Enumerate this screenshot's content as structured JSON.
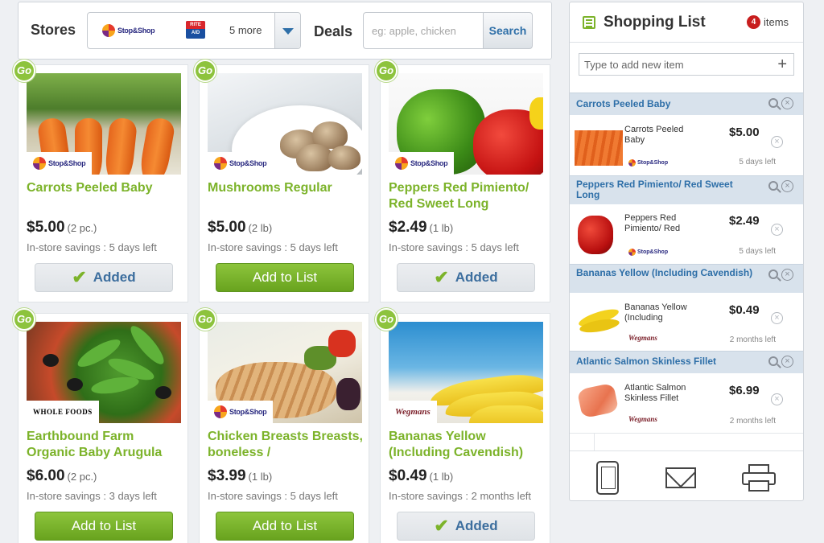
{
  "search": {
    "stores_label": "Stores",
    "store_logos": [
      "Stop&Shop",
      "RITE AID"
    ],
    "more_stores": "5 more",
    "deals_label": "Deals",
    "deals_placeholder": "eg: apple, chicken",
    "search_label": "Search"
  },
  "products": [
    {
      "title": "Carrots Peeled Baby",
      "price": "$5.00",
      "qty": "(2 pc.)",
      "savings": "In-store savings : 5 days left",
      "store": "Stop&Shop",
      "action": "Added",
      "badge": "Go"
    },
    {
      "title": "Mushrooms Regular",
      "price": "$5.00",
      "qty": "(2 lb)",
      "savings": "In-store savings : 5 days left",
      "store": "Stop&Shop",
      "action": "Add to List",
      "badge": "Go"
    },
    {
      "title": "Peppers Red Pimiento/ Red Sweet Long",
      "price": "$2.49",
      "qty": "(1 lb)",
      "savings": "In-store savings : 5 days left",
      "store": "Stop&Shop",
      "action": "Added",
      "badge": "Go"
    },
    {
      "title": "Earthbound Farm Organic Baby Arugula",
      "price": "$6.00",
      "qty": "(2 pc.)",
      "savings": "In-store savings : 3 days left",
      "store": "WHOLE FOODS",
      "action": "Add to List",
      "badge": "Go"
    },
    {
      "title": "Chicken Breasts Breasts, boneless /",
      "price": "$3.99",
      "qty": "(1 lb)",
      "savings": "In-store savings : 5 days left",
      "store": "Stop&Shop",
      "action": "Add to List",
      "badge": "Go"
    },
    {
      "title": "Bananas Yellow (Including Cavendish)",
      "price": "$0.49",
      "qty": "(1 lb)",
      "savings": "In-store savings : 2 months left",
      "store": "Wegmans",
      "action": "Added",
      "badge": "Go"
    }
  ],
  "shopping_list": {
    "title": "Shopping List",
    "count": "4",
    "count_label": "items",
    "add_placeholder": "Type to add new item",
    "add_symbol": "+",
    "items": [
      {
        "section": "Carrots Peeled Baby",
        "name": "Carrots Peeled Baby",
        "price": "$5.00",
        "store": "Stop&Shop",
        "time": "5 days left"
      },
      {
        "section": "Peppers Red Pimiento/ Red Sweet Long",
        "name": "Peppers Red Pimiento/ Red",
        "price": "$2.49",
        "store": "Stop&Shop",
        "time": "5 days left"
      },
      {
        "section": "Bananas Yellow (Including Cavendish)",
        "name": "Bananas Yellow (Including",
        "price": "$0.49",
        "store": "Wegmans",
        "time": "2 months left"
      },
      {
        "section": "Atlantic Salmon Skinless Fillet",
        "name": "Atlantic Salmon Skinless Fillet",
        "price": "$6.99",
        "store": "Wegmans",
        "time": "2 months left"
      }
    ]
  },
  "colors": {
    "accent_green": "#7cb32a",
    "link_blue": "#2e6fa8",
    "badge_red": "#c81e1e",
    "section_bg": "#d8e2ec"
  },
  "icons": [
    "list-icon",
    "plus-icon",
    "magnifier-icon",
    "remove-icon",
    "phone-icon",
    "mail-icon",
    "printer-icon",
    "check-icon",
    "dropdown-arrow-icon",
    "go-badge-icon"
  ]
}
